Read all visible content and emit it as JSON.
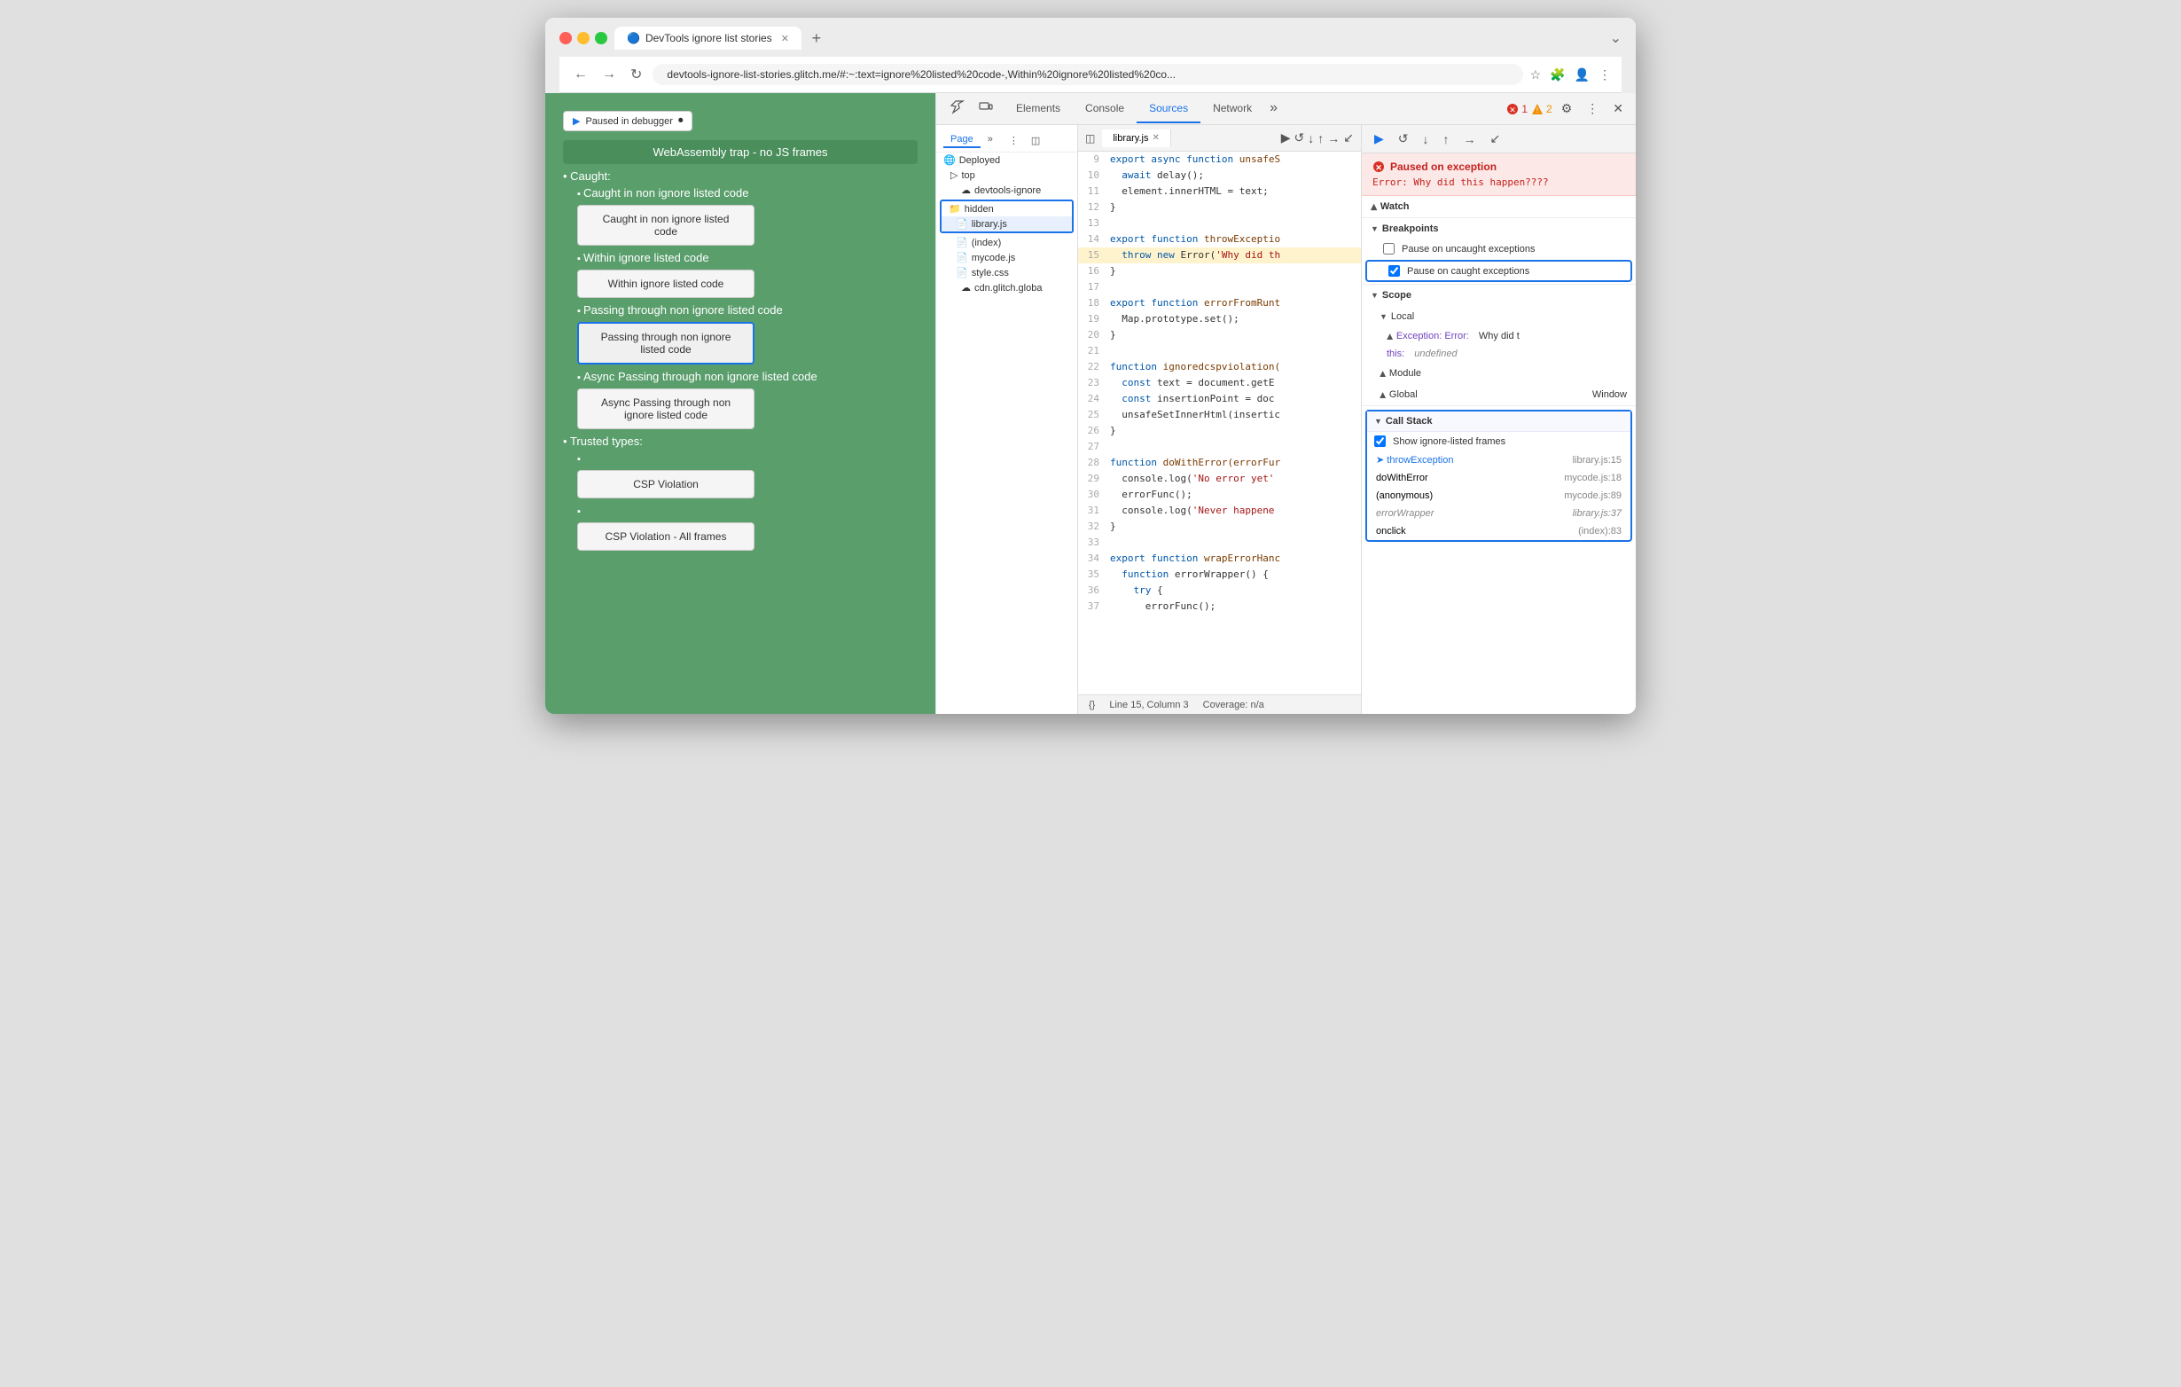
{
  "browser": {
    "tab_title": "DevTools ignore list stories",
    "tab_favicon": "🔵",
    "address": "devtools-ignore-list-stories.glitch.me/#:~:text=ignore%20listed%20code-,Within%20ignore%20listed%20co...",
    "new_tab_label": "+",
    "nav": {
      "back": "←",
      "forward": "→",
      "refresh": "↻",
      "bookmark": "☆",
      "extensions": "🧩",
      "account": "👤",
      "more": "⋮"
    }
  },
  "webpage": {
    "paused_badge": "Paused in debugger",
    "nav_item": "WebAssembly trap - no JS frames",
    "caught_label": "Caught:",
    "items": [
      {
        "label": "Caught in non ignore listed code",
        "btn_label": "Caught in non ignore listed code",
        "active": false
      },
      {
        "label": "Within ignore listed code",
        "btn_label": "Within ignore listed code",
        "active": false
      },
      {
        "label": "Passing through non ignore listed code",
        "btn_label": "Passing through non ignore listed code",
        "active": true
      },
      {
        "label": "Async Passing through non ignore listed code",
        "btn_label": "Async Passing through non ignore listed code",
        "active": false
      }
    ],
    "trusted_types_label": "Trusted types:",
    "trusted_items": [
      {
        "btn_label": "CSP Violation"
      },
      {
        "btn_label": "CSP Violation - All frames"
      }
    ]
  },
  "devtools": {
    "toolbar": {
      "inspect_icon": "⛶",
      "device_icon": "⬜",
      "tabs": [
        "Elements",
        "Console",
        "Sources",
        "Network",
        ">>"
      ],
      "active_tab": "Sources",
      "error_count": "1",
      "warn_count": "2",
      "settings_icon": "⚙",
      "more_icon": "⋮",
      "close_icon": "✕"
    },
    "sources": {
      "file_tree": {
        "page_tab": "Page",
        "more_icon": ">>",
        "menu_icon": "⋮",
        "toggle_icon": "◫",
        "items": [
          {
            "label": "Deployed",
            "indent": 0,
            "icon": "🌐",
            "type": "folder"
          },
          {
            "label": "top",
            "indent": 1,
            "icon": "▷",
            "type": "frame"
          },
          {
            "label": "devtools-ignore",
            "indent": 2,
            "icon": "☁",
            "type": "domain",
            "partial": true
          },
          {
            "label": "hidden",
            "indent": 3,
            "icon": "📁",
            "type": "folder",
            "highlighted": true
          },
          {
            "label": "library.js",
            "indent": 4,
            "icon": "📄",
            "type": "file",
            "selected": true
          },
          {
            "label": "(index)",
            "indent": 3,
            "icon": "📄",
            "type": "file"
          },
          {
            "label": "mycode.js",
            "indent": 3,
            "icon": "📄",
            "type": "file",
            "orange": true
          },
          {
            "label": "style.css",
            "indent": 3,
            "icon": "📄",
            "type": "file",
            "orange": true
          },
          {
            "label": "cdn.glitch.globa",
            "indent": 2,
            "icon": "☁",
            "type": "domain",
            "partial": true
          }
        ]
      },
      "editor": {
        "file_tab": "library.js",
        "lines": [
          {
            "num": "9",
            "text": "export async function unsafeS"
          },
          {
            "num": "10",
            "text": "  await delay();"
          },
          {
            "num": "11",
            "text": "  element.innerHTML = text;"
          },
          {
            "num": "12",
            "text": "}"
          },
          {
            "num": "13",
            "text": ""
          },
          {
            "num": "14",
            "text": "export function throwExceptio"
          },
          {
            "num": "15",
            "text": "  throw new Error('Why did th",
            "highlighted": true
          },
          {
            "num": "16",
            "text": "}"
          },
          {
            "num": "17",
            "text": ""
          },
          {
            "num": "18",
            "text": "export function errorFromRunt"
          },
          {
            "num": "19",
            "text": "  Map.prototype.set();"
          },
          {
            "num": "20",
            "text": "}"
          },
          {
            "num": "21",
            "text": ""
          },
          {
            "num": "22",
            "text": "function ignoredcspviolation("
          },
          {
            "num": "23",
            "text": "  const text = document.getE"
          },
          {
            "num": "24",
            "text": "  const insertionPoint = doc"
          },
          {
            "num": "25",
            "text": "  unsafeSetInnerHtml(insertic"
          },
          {
            "num": "26",
            "text": "}"
          },
          {
            "num": "27",
            "text": ""
          },
          {
            "num": "28",
            "text": "function doWithError(errorFur"
          },
          {
            "num": "29",
            "text": "  console.log('No error yet'"
          },
          {
            "num": "30",
            "text": "  errorFunc();"
          },
          {
            "num": "31",
            "text": "  console.log('Never happene"
          },
          {
            "num": "32",
            "text": "}"
          },
          {
            "num": "33",
            "text": ""
          },
          {
            "num": "34",
            "text": "export function wrapErrorHanc"
          },
          {
            "num": "35",
            "text": "  function errorWrapper() {"
          },
          {
            "num": "36",
            "text": "    try {"
          },
          {
            "num": "37",
            "text": "      errorFunc();"
          }
        ],
        "status_bar": {
          "format_icon": "{}",
          "position": "Line 15, Column 3",
          "coverage": "Coverage: n/a"
        }
      }
    },
    "debugger": {
      "toolbar_btns": [
        "▶",
        "↺",
        "↓",
        "↑",
        "→",
        "↙"
      ],
      "exception_box": {
        "title": "Paused on exception",
        "message": "Error: Why did this happen????"
      },
      "watch_label": "Watch",
      "breakpoints_label": "Breakpoints",
      "pause_uncaught_label": "Pause on uncaught exceptions",
      "pause_caught_label": "Pause on caught exceptions",
      "pause_caught_checked": true,
      "pause_uncaught_checked": false,
      "scope_label": "Scope",
      "local_label": "Local",
      "local_items": [
        {
          "key": "Exception: Error:",
          "val": "Why did t"
        },
        {
          "key": "this:",
          "val": "undefined"
        }
      ],
      "module_label": "Module",
      "global_label": "Global",
      "global_val": "Window",
      "call_stack": {
        "label": "Call Stack",
        "show_ignore_label": "Show ignore-listed frames",
        "show_ignore_checked": true,
        "frames": [
          {
            "name": "throwException",
            "location": "library.js:15",
            "active": true,
            "dimmed": false
          },
          {
            "name": "doWithError",
            "location": "mycode.js:18",
            "active": false,
            "dimmed": false
          },
          {
            "name": "(anonymous)",
            "location": "mycode.js:89",
            "active": false,
            "dimmed": false
          },
          {
            "name": "errorWrapper",
            "location": "library.js:37",
            "active": false,
            "dimmed": true
          },
          {
            "name": "onclick",
            "location": "(index):83",
            "active": false,
            "dimmed": false
          }
        ]
      }
    }
  }
}
